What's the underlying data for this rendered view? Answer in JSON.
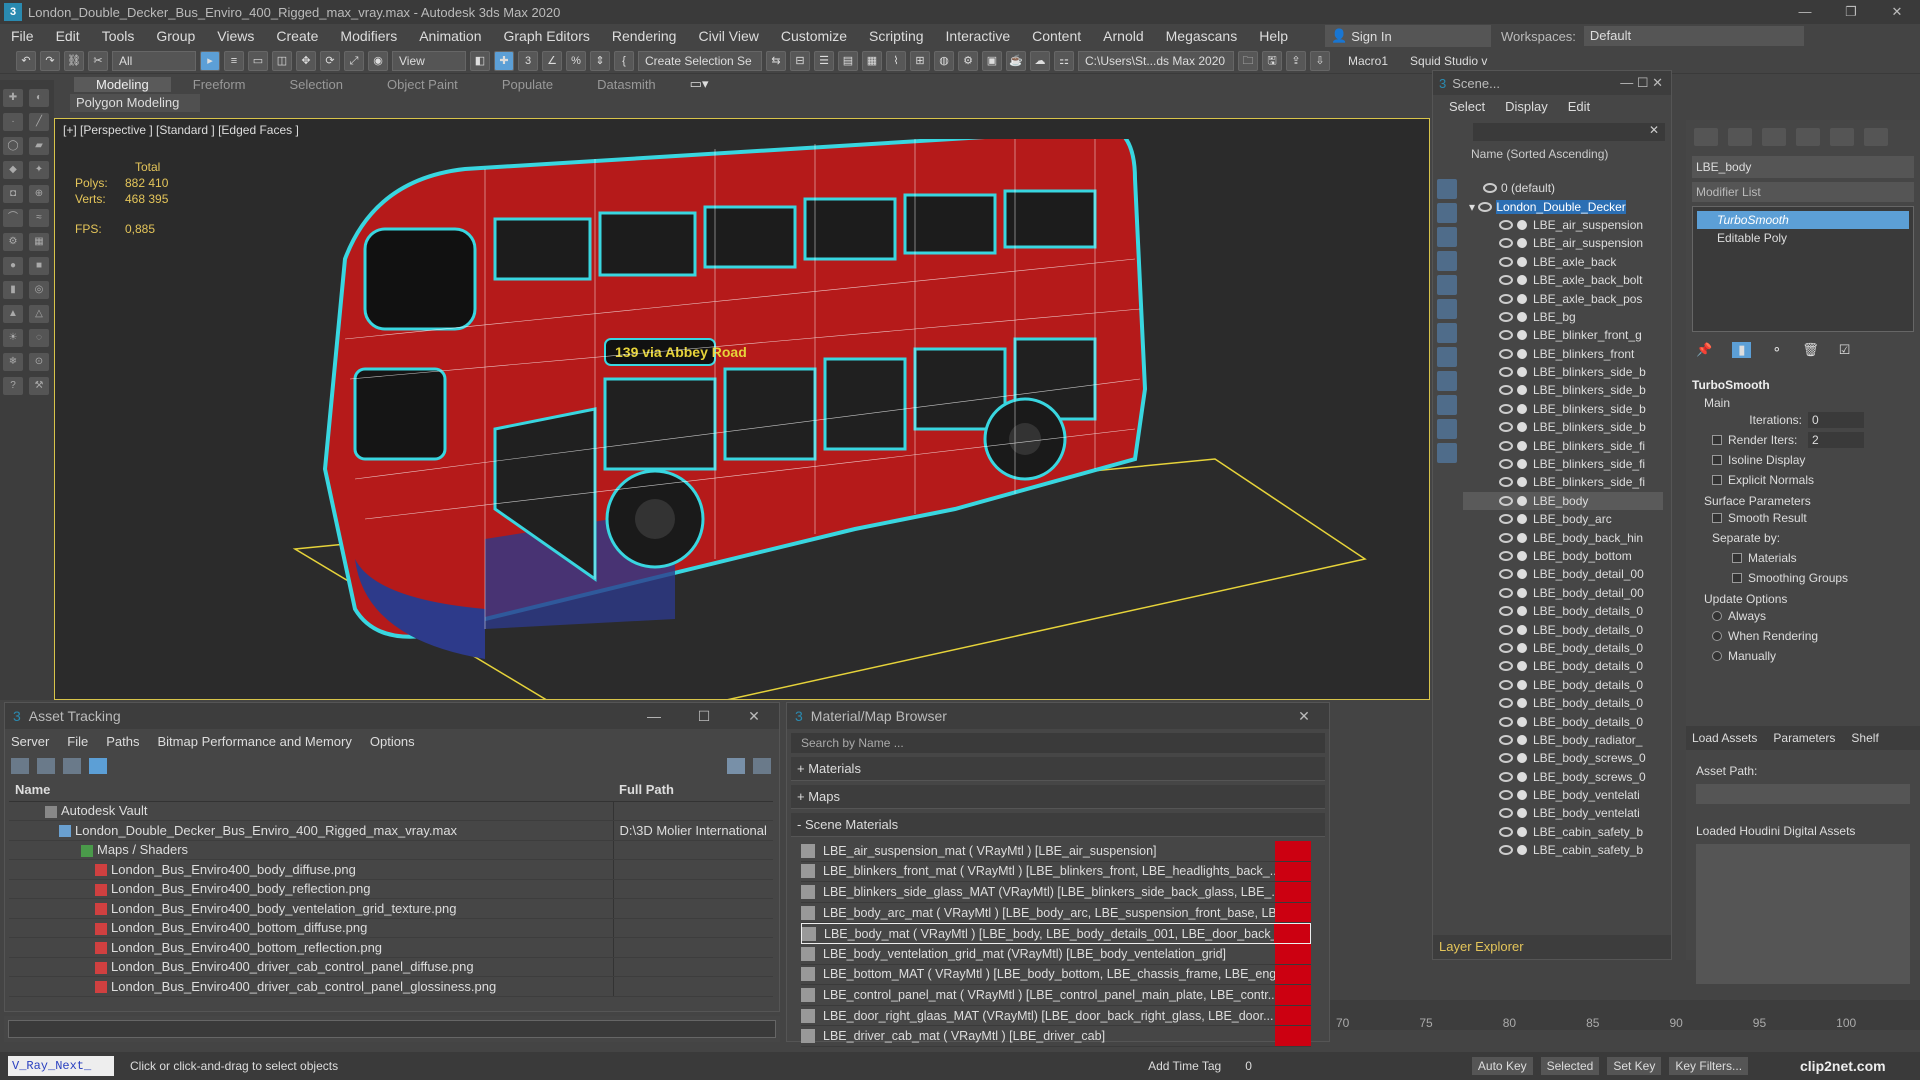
{
  "window": {
    "title": "London_Double_Decker_Bus_Enviro_400_Rigged_max_vray.max - Autodesk 3ds Max 2020"
  },
  "menu": [
    "File",
    "Edit",
    "Tools",
    "Group",
    "Views",
    "Create",
    "Modifiers",
    "Animation",
    "Graph Editors",
    "Rendering",
    "Civil View",
    "Customize",
    "Scripting",
    "Interactive",
    "Content",
    "Arnold",
    "Megascans",
    "Help"
  ],
  "signin": "Sign In",
  "workspace": {
    "label": "Workspaces:",
    "value": "Default"
  },
  "toolbar": {
    "filter": "All",
    "refcoord": "View",
    "selset": "Create Selection Se",
    "path": "C:\\Users\\St...ds Max 2020",
    "macro": "Macro1",
    "squid": "Squid Studio v"
  },
  "ribbon": {
    "tabs": [
      "Modeling",
      "Freeform",
      "Selection",
      "Object Paint",
      "Populate",
      "Datasmith"
    ],
    "sub": "Polygon Modeling"
  },
  "viewport": {
    "label": "[+] [Perspective ] [Standard ] [Edged Faces ]",
    "total": "Total",
    "polys_label": "Polys:",
    "polys": "882 410",
    "verts_label": "Verts:",
    "verts": "468 395",
    "fps_label": "FPS:",
    "fps": "0,885",
    "bus_route": "139 via Abbey Road"
  },
  "scene": {
    "title": "Scene...",
    "menu": [
      "Select",
      "Display",
      "Edit"
    ],
    "col": "Name (Sorted Ascending)",
    "footer": "Layer Explorer",
    "items": [
      "0 (default)",
      "London_Double_Decker",
      "LBE_air_suspension",
      "LBE_air_suspension",
      "LBE_axle_back",
      "LBE_axle_back_bolt",
      "LBE_axle_back_pos",
      "LBE_bg",
      "LBE_blinker_front_g",
      "LBE_blinkers_front",
      "LBE_blinkers_side_b",
      "LBE_blinkers_side_b",
      "LBE_blinkers_side_b",
      "LBE_blinkers_side_b",
      "LBE_blinkers_side_fi",
      "LBE_blinkers_side_fi",
      "LBE_blinkers_side_fi",
      "LBE_body",
      "LBE_body_arc",
      "LBE_body_back_hin",
      "LBE_body_bottom",
      "LBE_body_detail_00",
      "LBE_body_detail_00",
      "LBE_body_details_0",
      "LBE_body_details_0",
      "LBE_body_details_0",
      "LBE_body_details_0",
      "LBE_body_details_0",
      "LBE_body_details_0",
      "LBE_body_details_0",
      "LBE_body_radiator_",
      "LBE_body_screws_0",
      "LBE_body_screws_0",
      "LBE_body_ventelati",
      "LBE_body_ventelati",
      "LBE_cabin_safety_b",
      "LBE_cabin_safety_b"
    ]
  },
  "cmd": {
    "objname": "LBE_body",
    "modlist": "Modifier List",
    "stack": [
      "TurboSmooth",
      "Editable Poly"
    ],
    "ts": {
      "title": "TurboSmooth",
      "main": "Main",
      "iter_label": "Iterations:",
      "iter": "0",
      "render_label": "Render Iters:",
      "render": "2",
      "isoline": "Isoline Display",
      "explicit": "Explicit Normals",
      "surface": "Surface Parameters",
      "smooth": "Smooth Result",
      "sepby": "Separate by:",
      "materials": "Materials",
      "sg": "Smoothing Groups",
      "update": "Update Options",
      "always": "Always",
      "whenr": "When Rendering",
      "manually": "Manually"
    },
    "tabs": [
      "Load Assets",
      "Parameters",
      "Shelf"
    ],
    "assetpath": "Asset Path:",
    "loaded": "Loaded Houdini Digital Assets"
  },
  "asset": {
    "title": "Asset Tracking",
    "menu": [
      "Server",
      "File",
      "Paths",
      "Bitmap Performance and Memory",
      "Options"
    ],
    "cols": [
      "Name",
      "Full Path"
    ],
    "rows": [
      {
        "name": "Autodesk Vault",
        "path": ""
      },
      {
        "name": "London_Double_Decker_Bus_Enviro_400_Rigged_max_vray.max",
        "path": "D:\\3D Molier International"
      },
      {
        "name": "Maps / Shaders",
        "path": ""
      },
      {
        "name": "London_Bus_Enviro400_body_diffuse.png",
        "path": ""
      },
      {
        "name": "London_Bus_Enviro400_body_reflection.png",
        "path": ""
      },
      {
        "name": "London_Bus_Enviro400_body_ventelation_grid_texture.png",
        "path": ""
      },
      {
        "name": "London_Bus_Enviro400_bottom_diffuse.png",
        "path": ""
      },
      {
        "name": "London_Bus_Enviro400_bottom_reflection.png",
        "path": ""
      },
      {
        "name": "London_Bus_Enviro400_driver_cab_control_panel_diffuse.png",
        "path": ""
      },
      {
        "name": "London_Bus_Enviro400_driver_cab_control_panel_glossiness.png",
        "path": ""
      }
    ]
  },
  "mat": {
    "title": "Material/Map Browser",
    "search": "Search by Name ...",
    "groups": [
      "+ Materials",
      "+ Maps",
      "- Scene Materials"
    ],
    "rows": [
      "LBE_air_suspension_mat ( VRayMtl ) [LBE_air_suspension]",
      "LBE_blinkers_front_mat ( VRayMtl ) [LBE_blinkers_front, LBE_headlights_back_...",
      "LBE_blinkers_side_glass_MAT (VRayMtl) [LBE_blinkers_side_back_glass, LBE_...",
      "LBE_body_arc_mat ( VRayMtl ) [LBE_body_arc, LBE_suspension_front_base, LB...",
      "LBE_body_mat ( VRayMtl ) [LBE_body, LBE_body_details_001, LBE_door_back_...",
      "LBE_body_ventelation_grid_mat (VRayMtl) [LBE_body_ventelation_grid]",
      "LBE_bottom_MAT ( VRayMtl ) [LBE_body_bottom, LBE_chassis_frame, LBE_eng...",
      "LBE_control_panel_mat ( VRayMtl ) [LBE_control_panel_main_plate, LBE_contr...",
      "LBE_door_right_glaas_MAT (VRayMtl) [LBE_door_back_right_glass, LBE_door...",
      "LBE_driver_cab_mat ( VRayMtl ) [LBE_driver_cab]"
    ]
  },
  "timeline": [
    "70",
    "75",
    "80",
    "85",
    "90",
    "95",
    "100"
  ],
  "status": {
    "script": "V_Ray_Next_",
    "msg": "Click or click-and-drag to select objects",
    "addtag": "Add Time Tag",
    "autokey": "Auto Key",
    "selected": "Selected",
    "setkey": "Set Key",
    "keyfilters": "Key Filters...",
    "frame": "0"
  },
  "watermark": "clip2net.com"
}
